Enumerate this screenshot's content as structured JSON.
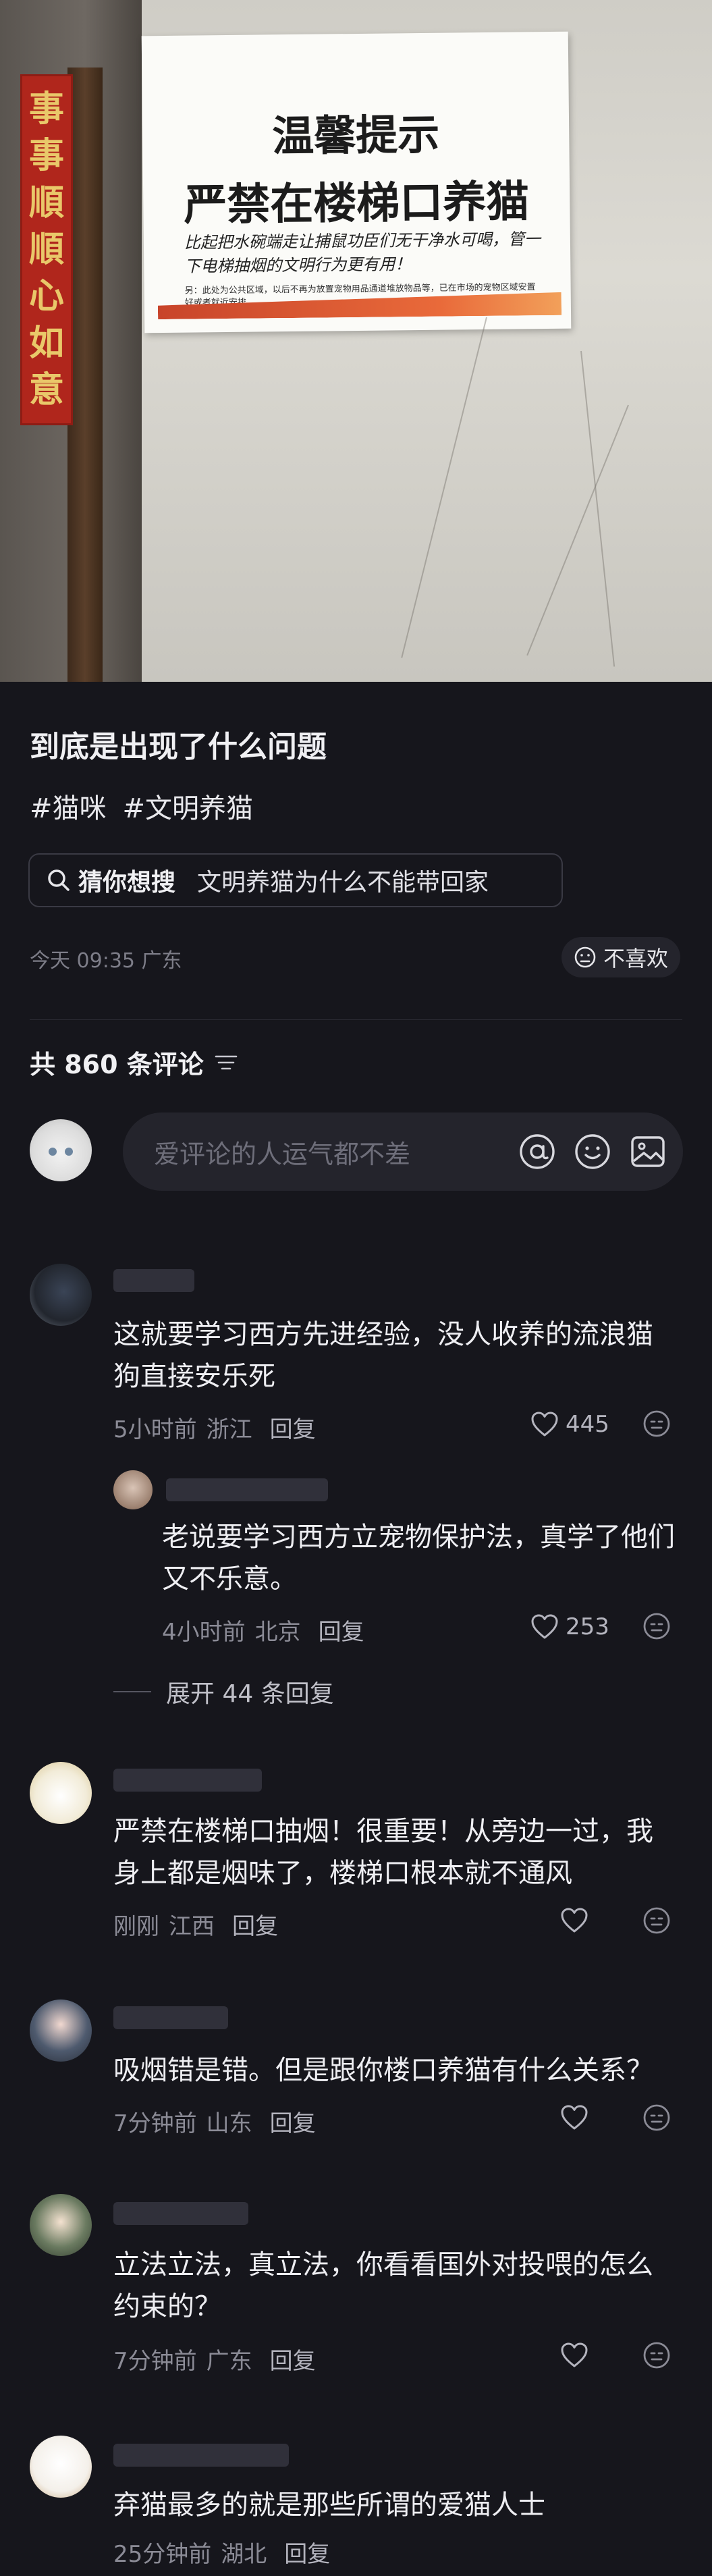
{
  "photo": {
    "couplet_chars": [
      "事",
      "事",
      "順",
      "順",
      "心",
      "如",
      "意"
    ],
    "notice_title": "温馨提示",
    "notice_subtitle": "严禁在楼梯口养猫",
    "notice_handwriting": "比起把水碗端走让捕鼠功臣们无干净水可喝，管一下电梯抽烟的文明行为更有用！",
    "notice_fineprint": "另：此处为公共区域，以后不再为放置宠物用品通道堆放物品等，已在市场的宠物区域安置好或者就近安排。"
  },
  "post": {
    "title": "到底是出现了什么问题",
    "tags": [
      "#猫咪",
      "#文明养猫"
    ],
    "search_hint": "猜你想搜",
    "search_query": "文明养猫为什么不能带回家",
    "meta": "今天 09:35 广东",
    "dislike_label": "不喜欢"
  },
  "comments_header": {
    "label": "共 860 条评论"
  },
  "comment_input": {
    "placeholder": "爱评论的人运气都不差"
  },
  "comments": [
    {
      "text": "这就要学习西方先进经验，没人收养的流浪猫狗直接安乐死",
      "time": "5小时前",
      "location": "浙江",
      "reply": "回复",
      "likes": "445"
    },
    {
      "text": "老说要学习西方立宠物保护法，真学了他们又不乐意。",
      "time": "4小时前",
      "location": "北京",
      "reply": "回复",
      "likes": "253"
    },
    {
      "text": "严禁在楼梯口抽烟！很重要！从旁边一过，我身上都是烟味了，楼梯口根本就不通风",
      "time": "刚刚",
      "location": "江西",
      "reply": "回复",
      "likes": ""
    },
    {
      "text": "吸烟错是错。但是跟你楼口养猫有什么关系？",
      "time": "7分钟前",
      "location": "山东",
      "reply": "回复",
      "likes": ""
    },
    {
      "text": "立法立法，真立法，你看看国外对投喂的怎么约束的？",
      "time": "7分钟前",
      "location": "广东",
      "reply": "回复",
      "likes": ""
    },
    {
      "text": "弃猫最多的就是那些所谓的爱猫人士",
      "time": "25分钟前",
      "location": "湖北",
      "reply": "回复",
      "likes": ""
    }
  ],
  "expand_replies": "展开 44 条回复",
  "colors": {
    "background": "#16161c",
    "input_bg": "#24242c",
    "muted_text": "#8b8b96",
    "couplet_red": "#b0261c",
    "notice_band": "#e96a3a"
  },
  "icons": [
    "search-icon",
    "filter-icon",
    "dislike-face-icon",
    "at-icon",
    "emoji-icon",
    "image-icon",
    "heart-icon",
    "more-icon"
  ]
}
